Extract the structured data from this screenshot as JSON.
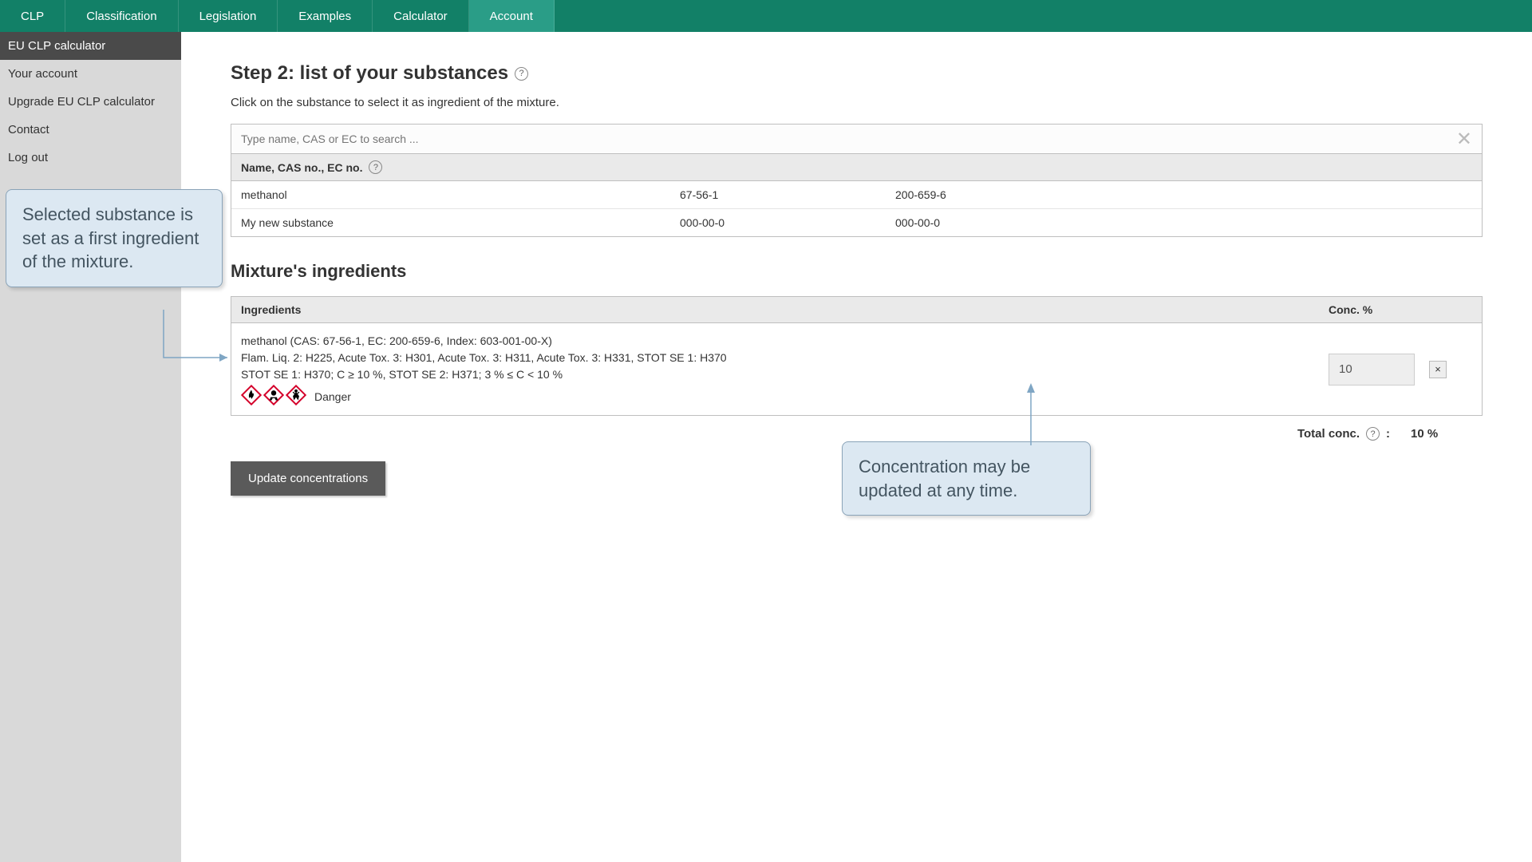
{
  "topnav": [
    "CLP",
    "Classification",
    "Legislation",
    "Examples",
    "Calculator",
    "Account"
  ],
  "topnav_active_index": 5,
  "sidebar": {
    "header": "EU CLP calculator",
    "items": [
      "Your account",
      "Upgrade EU CLP calculator",
      "Contact",
      "Log out"
    ]
  },
  "main": {
    "title": "Step 2:  list of your substances",
    "subtitle": "Click on the substance to select it as ingredient of the mixture.",
    "search_placeholder": "Type name, CAS or EC to search ...",
    "table_header": "Name, CAS no., EC no.",
    "substances": [
      {
        "name": "methanol",
        "cas": "67-56-1",
        "ec": "200-659-6"
      },
      {
        "name": "My new substance",
        "cas": "000-00-0",
        "ec": "000-00-0"
      }
    ],
    "ingredients_title": "Mixture's ingredients",
    "ing_header_left": "Ingredients",
    "ing_header_right": "Conc. %",
    "ingredient": {
      "title_line": "methanol (CAS: 67-56-1, EC: 200-659-6, Index: 603-001-00-X)",
      "hazard_line": "Flam. Liq. 2: H225,  Acute Tox. 3: H301,  Acute Tox. 3: H311,  Acute Tox. 3: H331,  STOT SE 1: H370",
      "limits_line": "STOT SE 1: H370; C ≥ 10 %,  STOT SE 2: H371; 3 % ≤ C < 10 %",
      "signal_word": "Danger",
      "conc_value": "10"
    },
    "total_label": "Total conc.",
    "total_value": "10 %",
    "update_button": "Update concentrations"
  },
  "callouts": {
    "c1": "Selected substance is set as a first ingredient of the mixture.",
    "c2": "Concentration may be updated at any time."
  }
}
